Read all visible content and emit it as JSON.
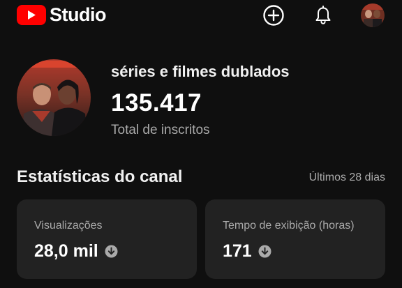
{
  "header": {
    "app_name": "Studio",
    "icons": [
      "youtube-logo-icon",
      "create-plus-icon",
      "bell-icon",
      "account-avatar"
    ],
    "brand_color": "#ff0000"
  },
  "channel": {
    "name": "séries e filmes dublados",
    "subscriber_count": "135.417",
    "subscriber_label": "Total de inscritos"
  },
  "stats": {
    "title": "Estatísticas do canal",
    "period": "Últimos 28 dias",
    "cards": [
      {
        "label": "Visualizações",
        "value": "28,0 mil",
        "trend_icon": "arrow-down-circle-icon"
      },
      {
        "label": "Tempo de exibição (horas)",
        "value": "171",
        "trend_icon": "arrow-down-circle-icon"
      }
    ]
  }
}
